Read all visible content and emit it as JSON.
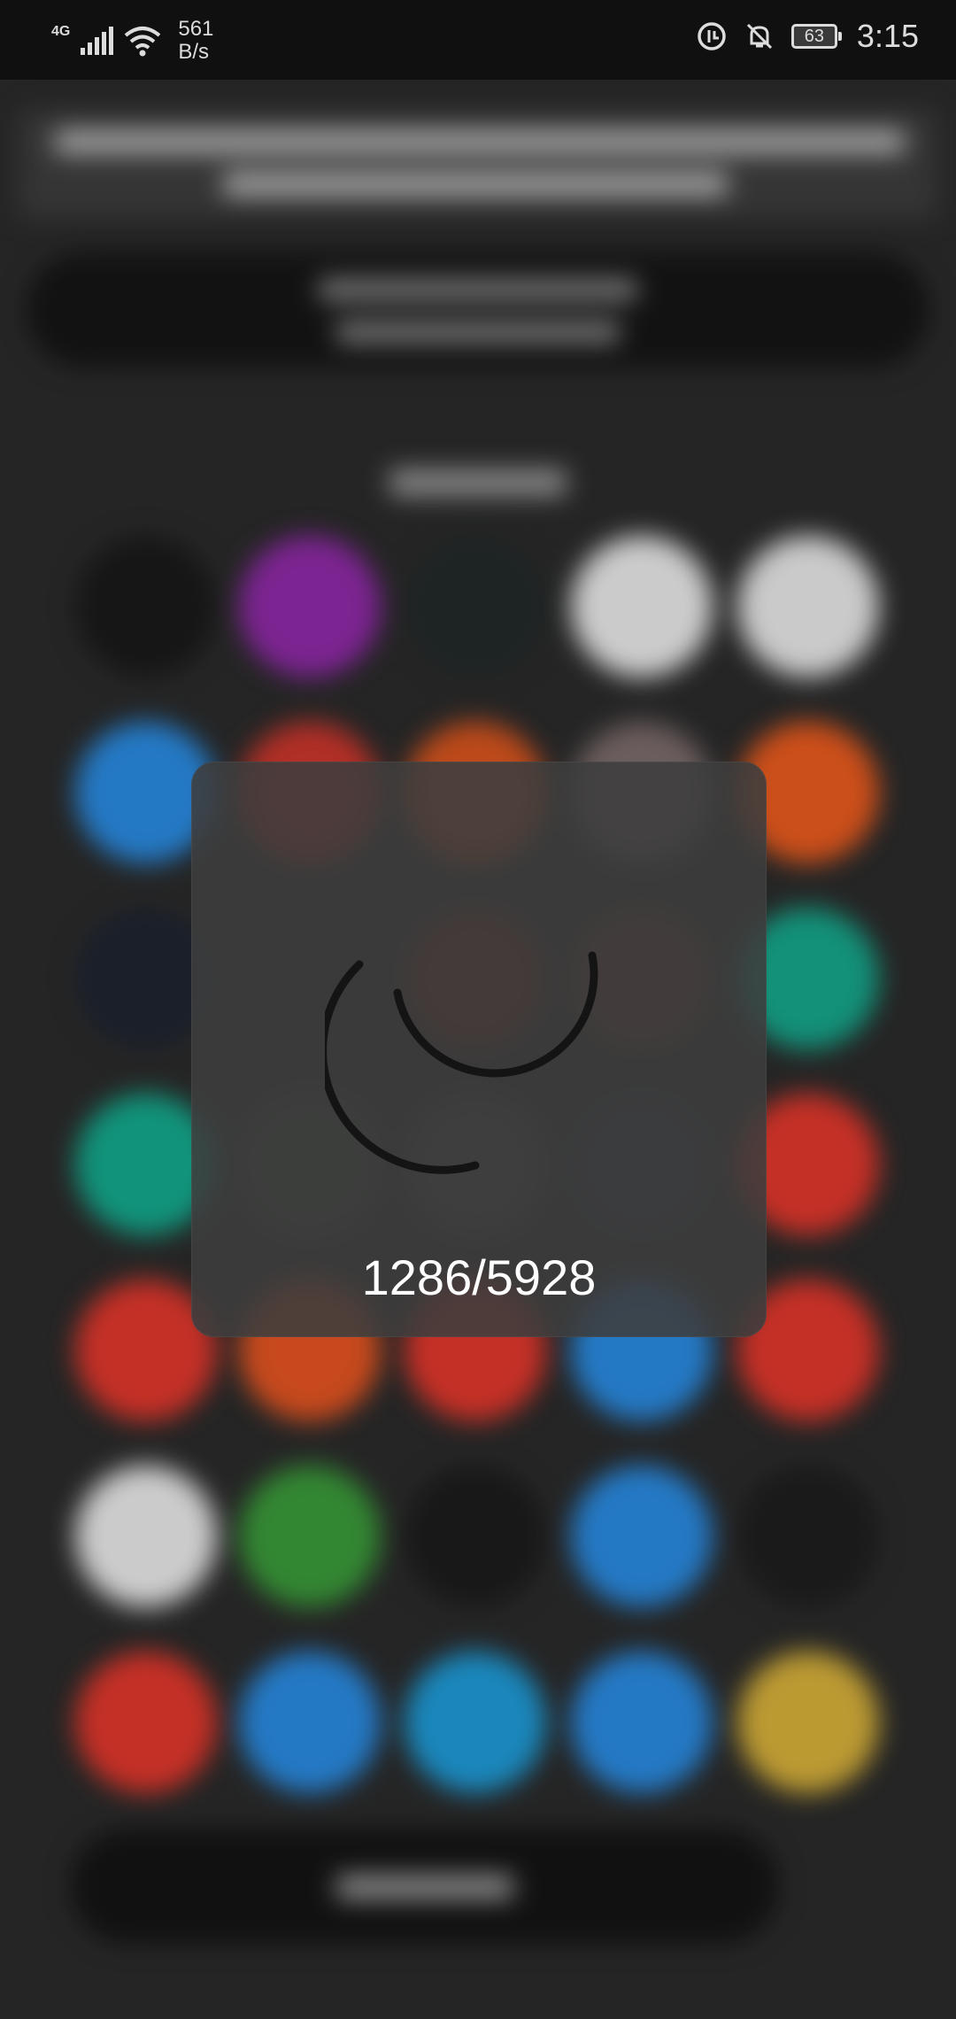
{
  "status_bar": {
    "network": "4G",
    "data_rate_value": "561",
    "data_rate_unit": "B/s",
    "battery": "63",
    "time": "3:15",
    "icons": [
      "signal-icon",
      "wifi-icon",
      "data-saver-icon",
      "mute-icon",
      "battery-icon"
    ]
  },
  "loading_dialog": {
    "progress_text": "1286/5928",
    "current": 1286,
    "total": 5928
  },
  "colors": {
    "background": "#2b2b2b",
    "status_bar": "#101010",
    "dialog": "#3e3e3e",
    "spinner": "#141414",
    "progress_text": "#ffffff"
  }
}
